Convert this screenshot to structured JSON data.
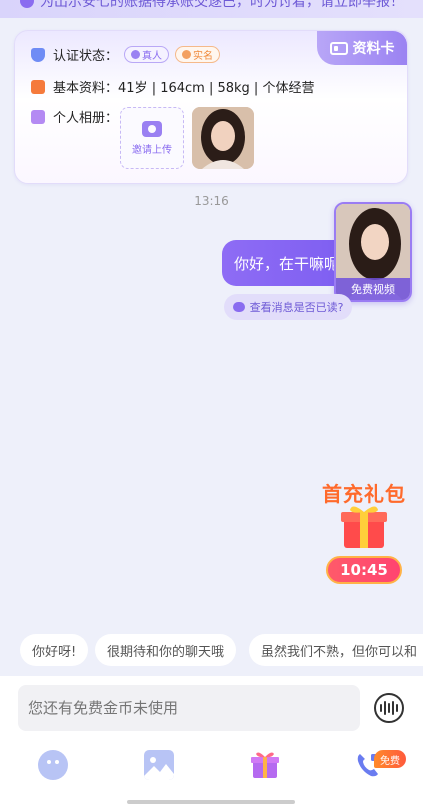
{
  "banner": {
    "text": "为出示安七的账据得承账交逐巴，时为讨着，请立即举报！"
  },
  "profile_card": {
    "tag_label": "资料卡",
    "verify_label": "认证状态：",
    "badge_real": "真人",
    "badge_name": "实名",
    "basic_label": "基本资料：",
    "basic_value": "41岁 | 164cm | 58kg | 个体经营",
    "album_label": "个人相册：",
    "upload_label": "邀请上传"
  },
  "chat": {
    "time": "13:16",
    "message": "你好，在干嘛呢",
    "video_label": "免费视频",
    "read_check": "查看消息是否已读?"
  },
  "promo": {
    "title": "首充礼包",
    "timer": "10:45"
  },
  "quick_replies": [
    "你好呀!",
    "很期待和你的聊天哦",
    "虽然我们不熟，但你可以和"
  ],
  "input": {
    "placeholder": "您还有免费金币未使用"
  },
  "toolbar": {
    "free_badge": "免费"
  },
  "colors": {
    "accent": "#8a6cf0",
    "promo": "#ff6a2b"
  }
}
